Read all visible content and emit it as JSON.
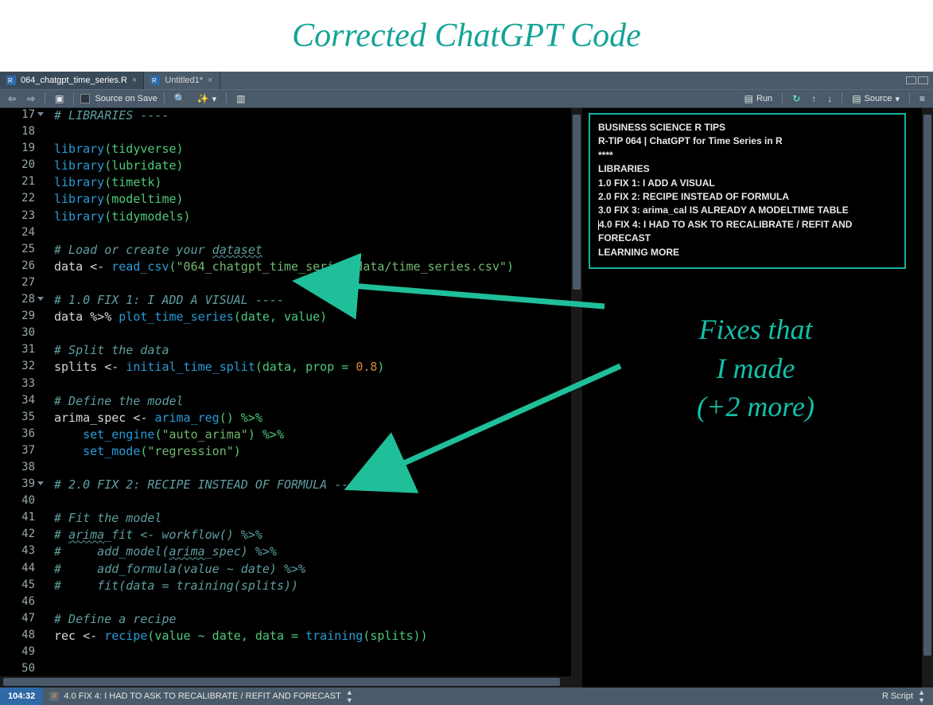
{
  "title": "Corrected ChatGPT Code",
  "tabs": [
    {
      "label": "064_chatgpt_time_series.R",
      "active": true
    },
    {
      "label": "Untitled1*",
      "active": false
    }
  ],
  "toolbar": {
    "source_on_save": "Source on Save",
    "run": "Run",
    "source": "Source"
  },
  "gutter_start": 17,
  "code": {
    "l17": "# LIBRARIES ----",
    "l18": "",
    "l19a": "library",
    "l19b": "(tidyverse)",
    "l20a": "library",
    "l20b": "(lubridate)",
    "l21a": "library",
    "l21b": "(timetk)",
    "l22a": "library",
    "l22b": "(modeltime)",
    "l23a": "library",
    "l23b": "(tidymodels)",
    "l24": "",
    "l25": "# Load or create your ",
    "l25u": "dataset",
    "l26a": "data <- ",
    "l26b": "read_csv",
    "l26c": "(",
    "l26d": "\"064_chatgpt_time_series/data/time_series.csv\"",
    "l26e": ")",
    "l27": "",
    "l28": "# 1.0 FIX 1: I ADD A VISUAL ----",
    "l29a": "data %>% ",
    "l29b": "plot_time_series",
    "l29c": "(date, value)",
    "l30": "",
    "l31": "# Split the data",
    "l32a": "splits <- ",
    "l32b": "initial_time_split",
    "l32c": "(data, prop = ",
    "l32d": "0.8",
    "l32e": ")",
    "l33": "",
    "l34": "# Define the model",
    "l35a": "arima_spec <- ",
    "l35b": "arima_reg",
    "l35c": "() %>%",
    "l36a": "    ",
    "l36b": "set_engine",
    "l36c": "(",
    "l36d": "\"auto_arima\"",
    "l36e": ") %>%",
    "l37a": "    ",
    "l37b": "set_mode",
    "l37c": "(",
    "l37d": "\"regression\"",
    "l37e": ")",
    "l38": "",
    "l39": "# 2.0 FIX 2: RECIPE INSTEAD OF FORMULA ----",
    "l40": "",
    "l41": "# Fit the model",
    "l42": "# ",
    "l42u": "arima",
    "l42b": "_fit <- workflow() %>%",
    "l43": "#     add_model(",
    "l43u": "arima",
    "l43b": "_spec) %>%",
    "l44": "#     add_formula(value ~ date) %>%",
    "l45": "#     fit(data = training(splits))",
    "l46": "",
    "l47": "# Define a recipe",
    "l48a": "rec <- ",
    "l48b": "recipe",
    "l48c": "(value ~ date, data = ",
    "l48d": "training",
    "l48e": "(splits))",
    "l49": "",
    "l50": ""
  },
  "outline": {
    "l1": "BUSINESS SCIENCE R TIPS",
    "l2": "R-TIP 064 | ChatGPT for Time Series in R",
    "l3": "****",
    "l4": "LIBRARIES",
    "l5": "1.0 FIX 1: I ADD A VISUAL",
    "l6": "2.0 FIX 2: RECIPE INSTEAD OF FORMULA",
    "l7": "3.0 FIX 3: arima_cal IS ALREADY A MODELTIME TABLE",
    "l8": "4.0 FIX 4: I HAD TO ASK TO RECALIBRATE / REFIT AND FORECAST",
    "l9": "LEARNING MORE"
  },
  "annotation": {
    "l1": "Fixes that",
    "l2": "I made",
    "l3": "(+2 more)"
  },
  "status": {
    "pos": "104:32",
    "crumb": "4.0 FIX 4: I HAD TO ASK TO RECALIBRATE / REFIT AND FORECAST",
    "lang": "R Script"
  }
}
